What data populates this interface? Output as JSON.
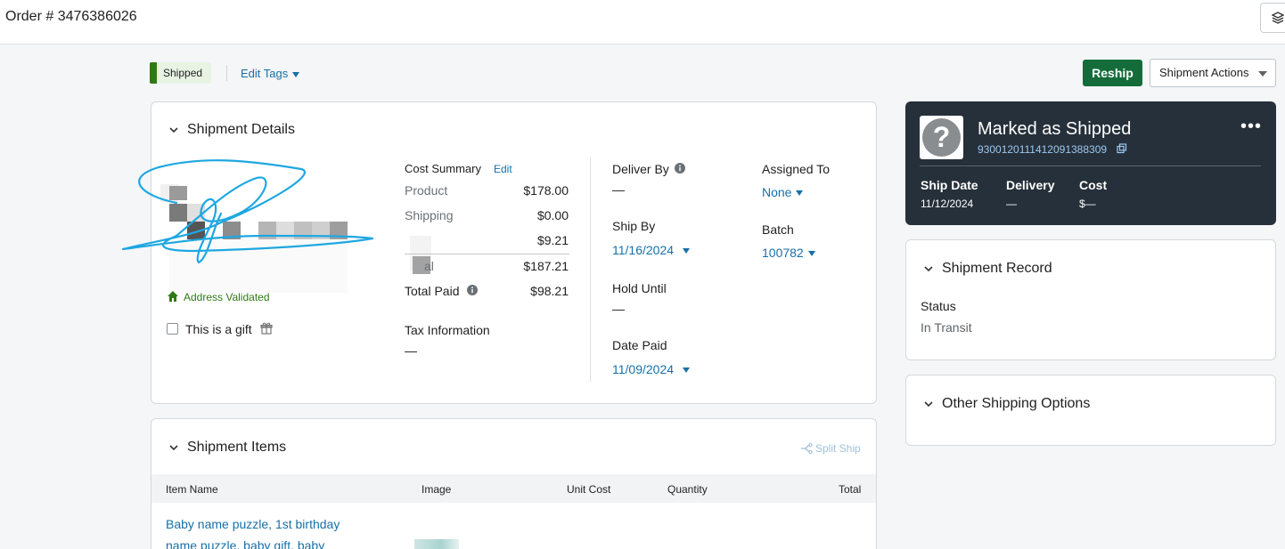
{
  "header": {
    "order_title": "Order # 3476386026",
    "layers_icon": "layers-icon"
  },
  "status_bar": {
    "status_label": "Shipped",
    "edit_tags_label": "Edit Tags"
  },
  "actions": {
    "reship_label": "Reship",
    "shipment_actions_label": "Shipment Actions"
  },
  "shipment_details": {
    "title": "Shipment Details",
    "address_validated": "Address Validated",
    "gift_label": "This is a gift",
    "cost_summary": {
      "title": "Cost Summary",
      "edit_label": "Edit",
      "rows": [
        {
          "label": "Product",
          "amount": "$178.00"
        },
        {
          "label": "Shipping",
          "amount": "$0.00"
        },
        {
          "label": "",
          "amount": "$9.21"
        },
        {
          "label": "al",
          "amount": "$187.21"
        },
        {
          "label": "Total Paid",
          "amount": "$98.21"
        }
      ]
    },
    "tax_information": {
      "label": "Tax Information",
      "value": "—"
    },
    "deliver_by": {
      "label": "Deliver By",
      "value": "—"
    },
    "ship_by": {
      "label": "Ship By",
      "value": "11/16/2024"
    },
    "hold_until": {
      "label": "Hold Until",
      "value": "—"
    },
    "date_paid": {
      "label": "Date Paid",
      "value": "11/09/2024"
    },
    "assigned_to": {
      "label": "Assigned To",
      "value": "None"
    },
    "batch": {
      "label": "Batch",
      "value": "100782"
    }
  },
  "shipment_status_card": {
    "title": "Marked as Shipped",
    "tracking_number": "9300120111412091388309",
    "ship_date_label": "Ship Date",
    "ship_date": "11/12/2024",
    "delivery_label": "Delivery",
    "delivery": "—",
    "cost_label": "Cost",
    "cost": "$—"
  },
  "shipment_record": {
    "title": "Shipment Record",
    "status_label": "Status",
    "status_value": "In Transit"
  },
  "other_shipping_options": {
    "title": "Other Shipping Options"
  },
  "shipment_items": {
    "title": "Shipment Items",
    "split_ship_label": "Split Ship",
    "columns": [
      "Item Name",
      "Image",
      "Unit Cost",
      "Quantity",
      "Total"
    ],
    "rows": [
      {
        "item_name_line1": "Baby name puzzle, 1st birthday",
        "item_name_line2": "name puzzle, baby gift, baby"
      }
    ]
  },
  "colors": {
    "accent_green": "#146c3a",
    "status_green": "#2f7a14",
    "link_blue": "#1670a8",
    "dark_card": "#26303a",
    "scribble": "#1ea7e1"
  }
}
